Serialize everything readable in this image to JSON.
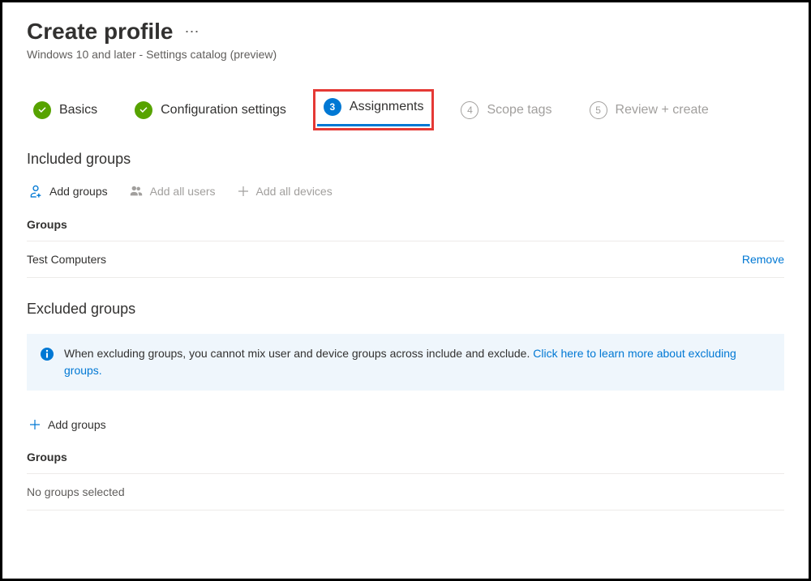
{
  "header": {
    "title": "Create profile",
    "subtitle": "Windows 10 and later - Settings catalog (preview)"
  },
  "steps": {
    "basics": "Basics",
    "config": "Configuration settings",
    "assignments": "Assignments",
    "assignments_num": "3",
    "scope": "Scope tags",
    "scope_num": "4",
    "review": "Review + create",
    "review_num": "5"
  },
  "included": {
    "title": "Included groups",
    "add_groups": "Add groups",
    "add_all_users": "Add all users",
    "add_all_devices": "Add all devices",
    "groups_header": "Groups",
    "group_name": "Test Computers",
    "remove": "Remove"
  },
  "excluded": {
    "title": "Excluded groups",
    "info_text": "When excluding groups, you cannot mix user and device groups across include and exclude. ",
    "info_link": "Click here to learn more about excluding groups.",
    "add_groups": "Add groups",
    "groups_header": "Groups",
    "empty": "No groups selected"
  }
}
